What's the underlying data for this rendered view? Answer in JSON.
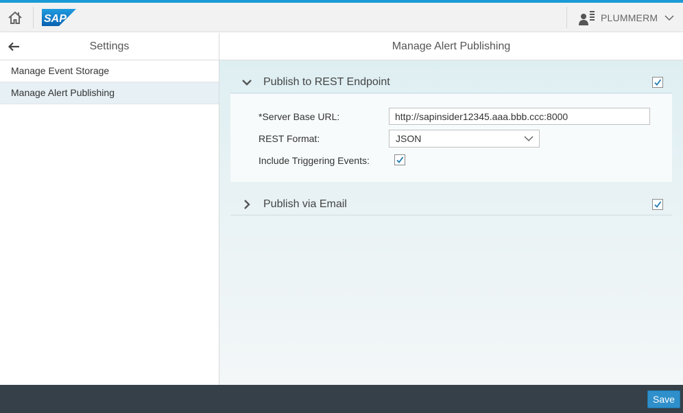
{
  "shell": {
    "home_icon": "home-icon",
    "logo_text": "SAP",
    "user": {
      "name": "PLUMMERM",
      "icon": "user-list-icon",
      "menu_icon": "chevron-down-icon"
    },
    "accent_color": "#1a9ad6"
  },
  "master": {
    "title": "Settings",
    "back_icon": "arrow-left-icon",
    "items": [
      {
        "label": "Manage Event Storage",
        "selected": false
      },
      {
        "label": "Manage Alert Publishing",
        "selected": true
      }
    ]
  },
  "detail": {
    "title": "Manage Alert Publishing",
    "panels": [
      {
        "title": "Publish to REST Endpoint",
        "expanded": true,
        "enabled": true,
        "fields": {
          "server_label": "*Server Base URL:",
          "server_value": "http://sapinsider12345.aaa.bbb.ccc:8000",
          "format_label": "REST Format:",
          "format_value": "JSON",
          "triggering_label": "Include Triggering Events:",
          "triggering_checked": true
        }
      },
      {
        "title": "Publish via Email",
        "expanded": false,
        "enabled": true
      }
    ]
  },
  "footer": {
    "save_label": "Save",
    "save_color": "#2e8fca"
  }
}
